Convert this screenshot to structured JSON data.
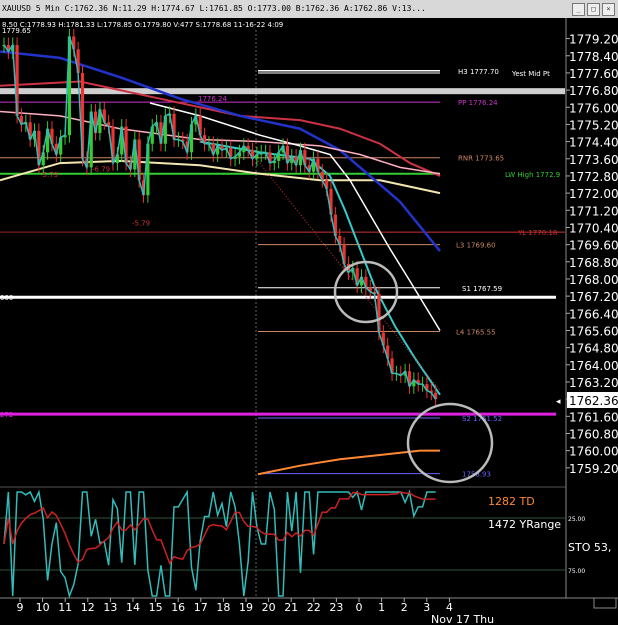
{
  "window": {
    "title": "XAUUSD 5 Min  C:1762.36  N:11.29  H:1774.67  L:1761.85  O:1773.00  B:1762.36  A:1762.86  V:13...",
    "info_line": "8.50  C:1778.93  H:1781.33  L:1778.85  O:1779.80  V:477  S:1778.68  11-16-22  4:09",
    "icons": [
      "minimize-icon",
      "restore-icon",
      "close-icon"
    ]
  },
  "chart_data": {
    "type": "candlestick",
    "title": "XAUUSD 5 Min",
    "current_price": "1762.36",
    "price_axis": {
      "min": 1758.4,
      "max": 1779.6,
      "ticks": [
        "1779.20",
        "1778.40",
        "1777.60",
        "1776.80",
        "1776.00",
        "1775.20",
        "1774.40",
        "1773.60",
        "1772.80",
        "1772.00",
        "1771.20",
        "1770.40",
        "1769.60",
        "1768.80",
        "1768.00",
        "1767.20",
        "1766.40",
        "1765.60",
        "1764.80",
        "1764.00",
        "1763.20",
        "1762.40",
        "1761.60",
        "1760.80",
        "1760.00",
        "1759.20"
      ]
    },
    "time_axis": {
      "ticks": [
        "9",
        "10",
        "11",
        "12",
        "13",
        "14",
        "15",
        "16",
        "17",
        "18",
        "19",
        "20",
        "21",
        "22",
        "23",
        "0",
        "1",
        "2",
        "3",
        "4"
      ],
      "date_label": "Nov 17 Thu"
    },
    "pivot_levels": [
      {
        "label": "H3 1777.70",
        "value": 1777.7,
        "color": "#ffffff"
      },
      {
        "label": "Yest Mid Pt",
        "value": 1777.55,
        "color": "#ffffff"
      },
      {
        "label": "PP 1776.24",
        "value": 1776.24,
        "color": "#cc33cc"
      },
      {
        "label": "RNR 1773.65",
        "value": 1773.65,
        "color": "#cc8866"
      },
      {
        "label": "LW High 1772.9",
        "value": 1772.9,
        "color": "#33cc33"
      },
      {
        "label": "YL 1770.18",
        "value": 1770.18,
        "color": "#cc3333"
      },
      {
        "label": "L3 1769.60",
        "value": 1769.6,
        "color": "#cc8866"
      },
      {
        "label": "S1 1767.59",
        "value": 1767.59,
        "color": "#ffffff"
      },
      {
        "label": "L4 1765.55",
        "value": 1765.55,
        "color": "#cc8866"
      },
      {
        "label": "S2 1761.52",
        "value": 1761.52,
        "color": "#6666ff"
      },
      {
        "label": "1758.93",
        "value": 1758.93,
        "color": "#6666ff"
      }
    ],
    "left_labels": [
      "-5.79",
      "-6.79",
      "-5.79",
      "1779.65",
      "1776.24"
    ],
    "side_labels": [
      "000",
      "272"
    ],
    "overlay_labels": [
      "1282 TD",
      "1472 YRange"
    ],
    "close_series": [
      1778.9,
      1778.6,
      1778.9,
      1775.6,
      1775.2,
      1775.3,
      1774.5,
      1774.9,
      1773.3,
      1773.9,
      1775.0,
      1774.3,
      1773.8,
      1774.6,
      1774.7,
      1779.3,
      1778.7,
      1777.6,
      1773.6,
      1773.2,
      1775.8,
      1774.8,
      1775.9,
      1775.3,
      1775.1,
      1773.4,
      1773.8,
      1775.1,
      1773.4,
      1773.1,
      1774.5,
      1772.6,
      1771.9,
      1774.3,
      1775.1,
      1775.3,
      1774.3,
      1775.6,
      1775.7,
      1774.5,
      1774.5,
      1774.4,
      1773.9,
      1775.2,
      1775.6,
      1774.7,
      1774.3,
      1774.3,
      1773.8,
      1774.2,
      1774.0,
      1774.1,
      1773.6,
      1773.7,
      1773.9,
      1774.2,
      1774.0,
      1773.6,
      1773.8,
      1773.9,
      1773.9,
      1773.4,
      1773.5,
      1773.9,
      1774.2,
      1773.4,
      1773.7,
      1773.3,
      1774.0,
      1773.3,
      1773.0,
      1773.6,
      1773.0,
      1772.6,
      1772.2,
      1771.0,
      1770.0,
      1769.6,
      1768.7,
      1768.3,
      1768.5,
      1767.7,
      1768.1,
      1767.6,
      1767.4,
      1767.3,
      1765.5,
      1764.9,
      1764.3,
      1763.6,
      1763.6,
      1763.5,
      1763.7,
      1763.0,
      1763.3,
      1763.1,
      1763.1,
      1762.8,
      1762.7,
      1762.4
    ],
    "stochastic": {
      "label": "STO 53,",
      "ticks": [
        "25.00",
        "75.00"
      ]
    }
  }
}
